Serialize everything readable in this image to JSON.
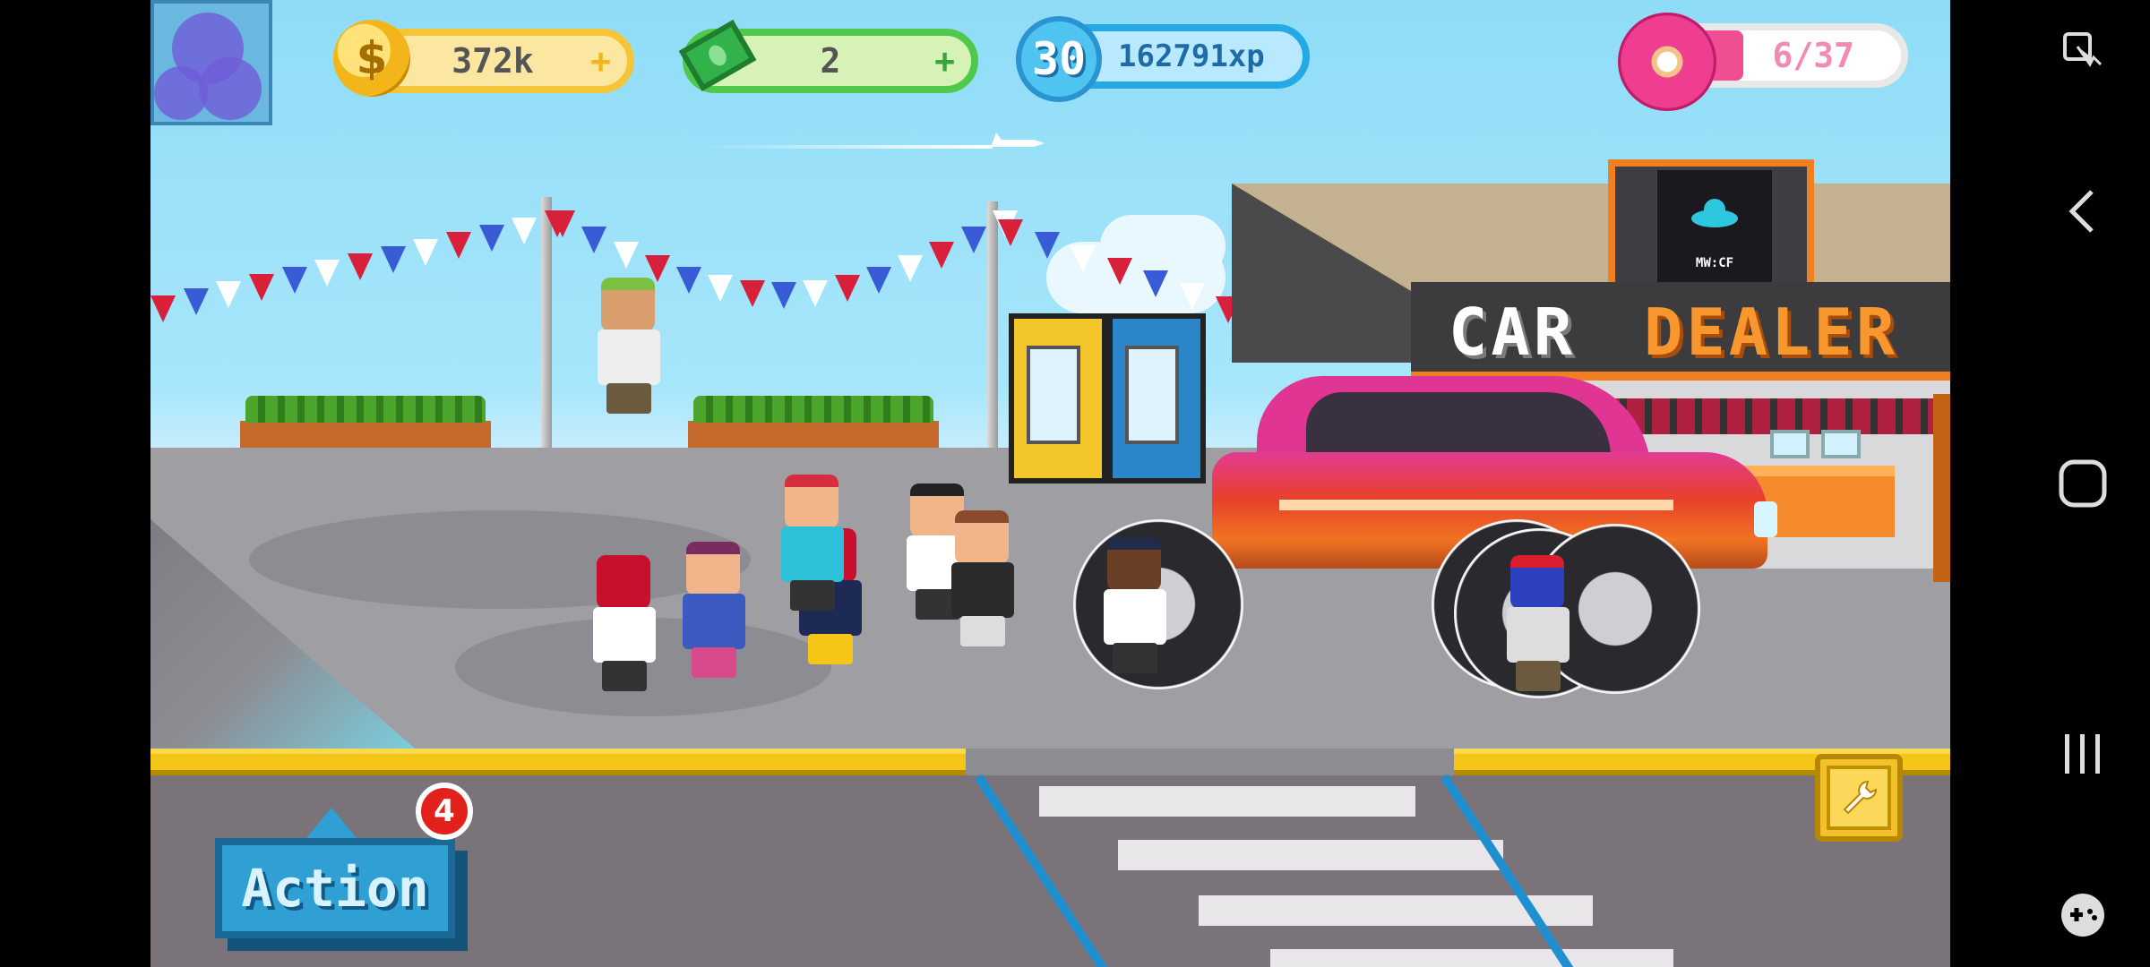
{
  "hud": {
    "coins": "372k",
    "coins_plus": "+",
    "coins_icon": "dollar-coin-icon",
    "cash": "2",
    "cash_plus": "+",
    "cash_icon": "cash-bill-icon",
    "level": "30",
    "xp": "162791xp",
    "donuts": "6/37",
    "donut_icon": "donut-icon"
  },
  "scene": {
    "sign_small": "MW:CF",
    "sign_car": "CAR",
    "sign_dealer": "DEALER"
  },
  "controls": {
    "action_label": "Action",
    "action_badge": "4",
    "tool_icon": "wrench-icon",
    "profile_icon": "profile-avatar-icon"
  },
  "system_nav": {
    "accessibility_icon": "accessibility-icon",
    "back_icon": "back-icon",
    "home_icon": "home-icon",
    "recents_icon": "recents-icon",
    "game_icon": "gamepad-icon"
  },
  "colors": {
    "sky": "#8fdcf7",
    "coin_pill": "#f6c537",
    "cash_pill": "#4fc94b",
    "xp_pill": "#25a9e4",
    "donut": "#ef3e8f",
    "action": "#2f9fd4",
    "badge": "#e2211c"
  }
}
